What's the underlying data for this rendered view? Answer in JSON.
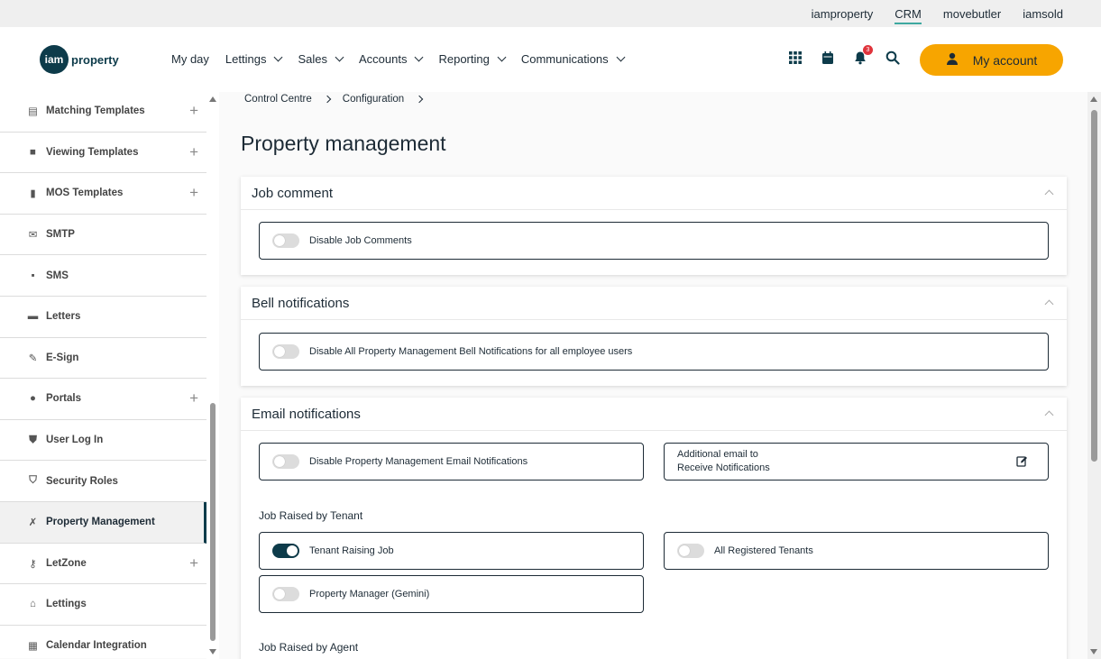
{
  "top_strip": {
    "brands": [
      "iamproperty",
      "CRM",
      "movebutler",
      "iamsold"
    ],
    "active": "CRM",
    "accent_color": "#3ea8a0"
  },
  "header": {
    "logo_mark": "iam",
    "logo_text": "property",
    "nav": [
      "My day",
      "Lettings",
      "Sales",
      "Accounts",
      "Reporting",
      "Communications"
    ],
    "notification_count": "3",
    "account_label": "My account",
    "account_color": "#f7a500"
  },
  "sidebar": {
    "items": [
      {
        "label": "Matching Templates",
        "icon": "template-icon",
        "expandable": true
      },
      {
        "label": "Viewing Templates",
        "icon": "alert-icon",
        "expandable": true
      },
      {
        "label": "MOS Templates",
        "icon": "document-icon",
        "expandable": true
      },
      {
        "label": "SMTP",
        "icon": "mail-icon",
        "expandable": false
      },
      {
        "label": "SMS",
        "icon": "sms-icon",
        "expandable": false
      },
      {
        "label": "Letters",
        "icon": "mailbox-icon",
        "expandable": false
      },
      {
        "label": "E-Sign",
        "icon": "pen-icon",
        "expandable": false
      },
      {
        "label": "Portals",
        "icon": "globe-icon",
        "expandable": true
      },
      {
        "label": "User Log In",
        "icon": "shield-icon",
        "expandable": false
      },
      {
        "label": "Security Roles",
        "icon": "shield-half-icon",
        "expandable": false
      },
      {
        "label": "Property Management",
        "icon": "wrench-icon",
        "expandable": false,
        "active": true
      },
      {
        "label": "LetZone",
        "icon": "key-icon",
        "expandable": true
      },
      {
        "label": "Lettings",
        "icon": "home-icon",
        "expandable": false
      },
      {
        "label": "Calendar Integration",
        "icon": "calendar-icon",
        "expandable": false
      }
    ]
  },
  "breadcrumb": [
    "Control Centre",
    "Configuration"
  ],
  "page_title": "Property management",
  "sections": {
    "job_comment": {
      "title": "Job comment",
      "options": [
        {
          "label": "Disable Job Comments",
          "on": false
        }
      ]
    },
    "bell": {
      "title": "Bell notifications",
      "options": [
        {
          "label": "Disable All Property Management Bell Notifications for all employee users",
          "on": false
        }
      ]
    },
    "email": {
      "title": "Email notifications",
      "disable_label": "Disable Property Management Email Notifications",
      "additional_label_1": "Additional email to",
      "additional_label_2": "Receive Notifications",
      "tenant_heading": "Job Raised by Tenant",
      "tenant_raising": "Tenant Raising Job",
      "all_tenants": "All Registered Tenants",
      "pm_gemini": "Property Manager (Gemini)",
      "agent_heading": "Job Raised by Agent"
    }
  },
  "colors": {
    "primary": "#0d3b4a",
    "text": "#1d2b36"
  }
}
